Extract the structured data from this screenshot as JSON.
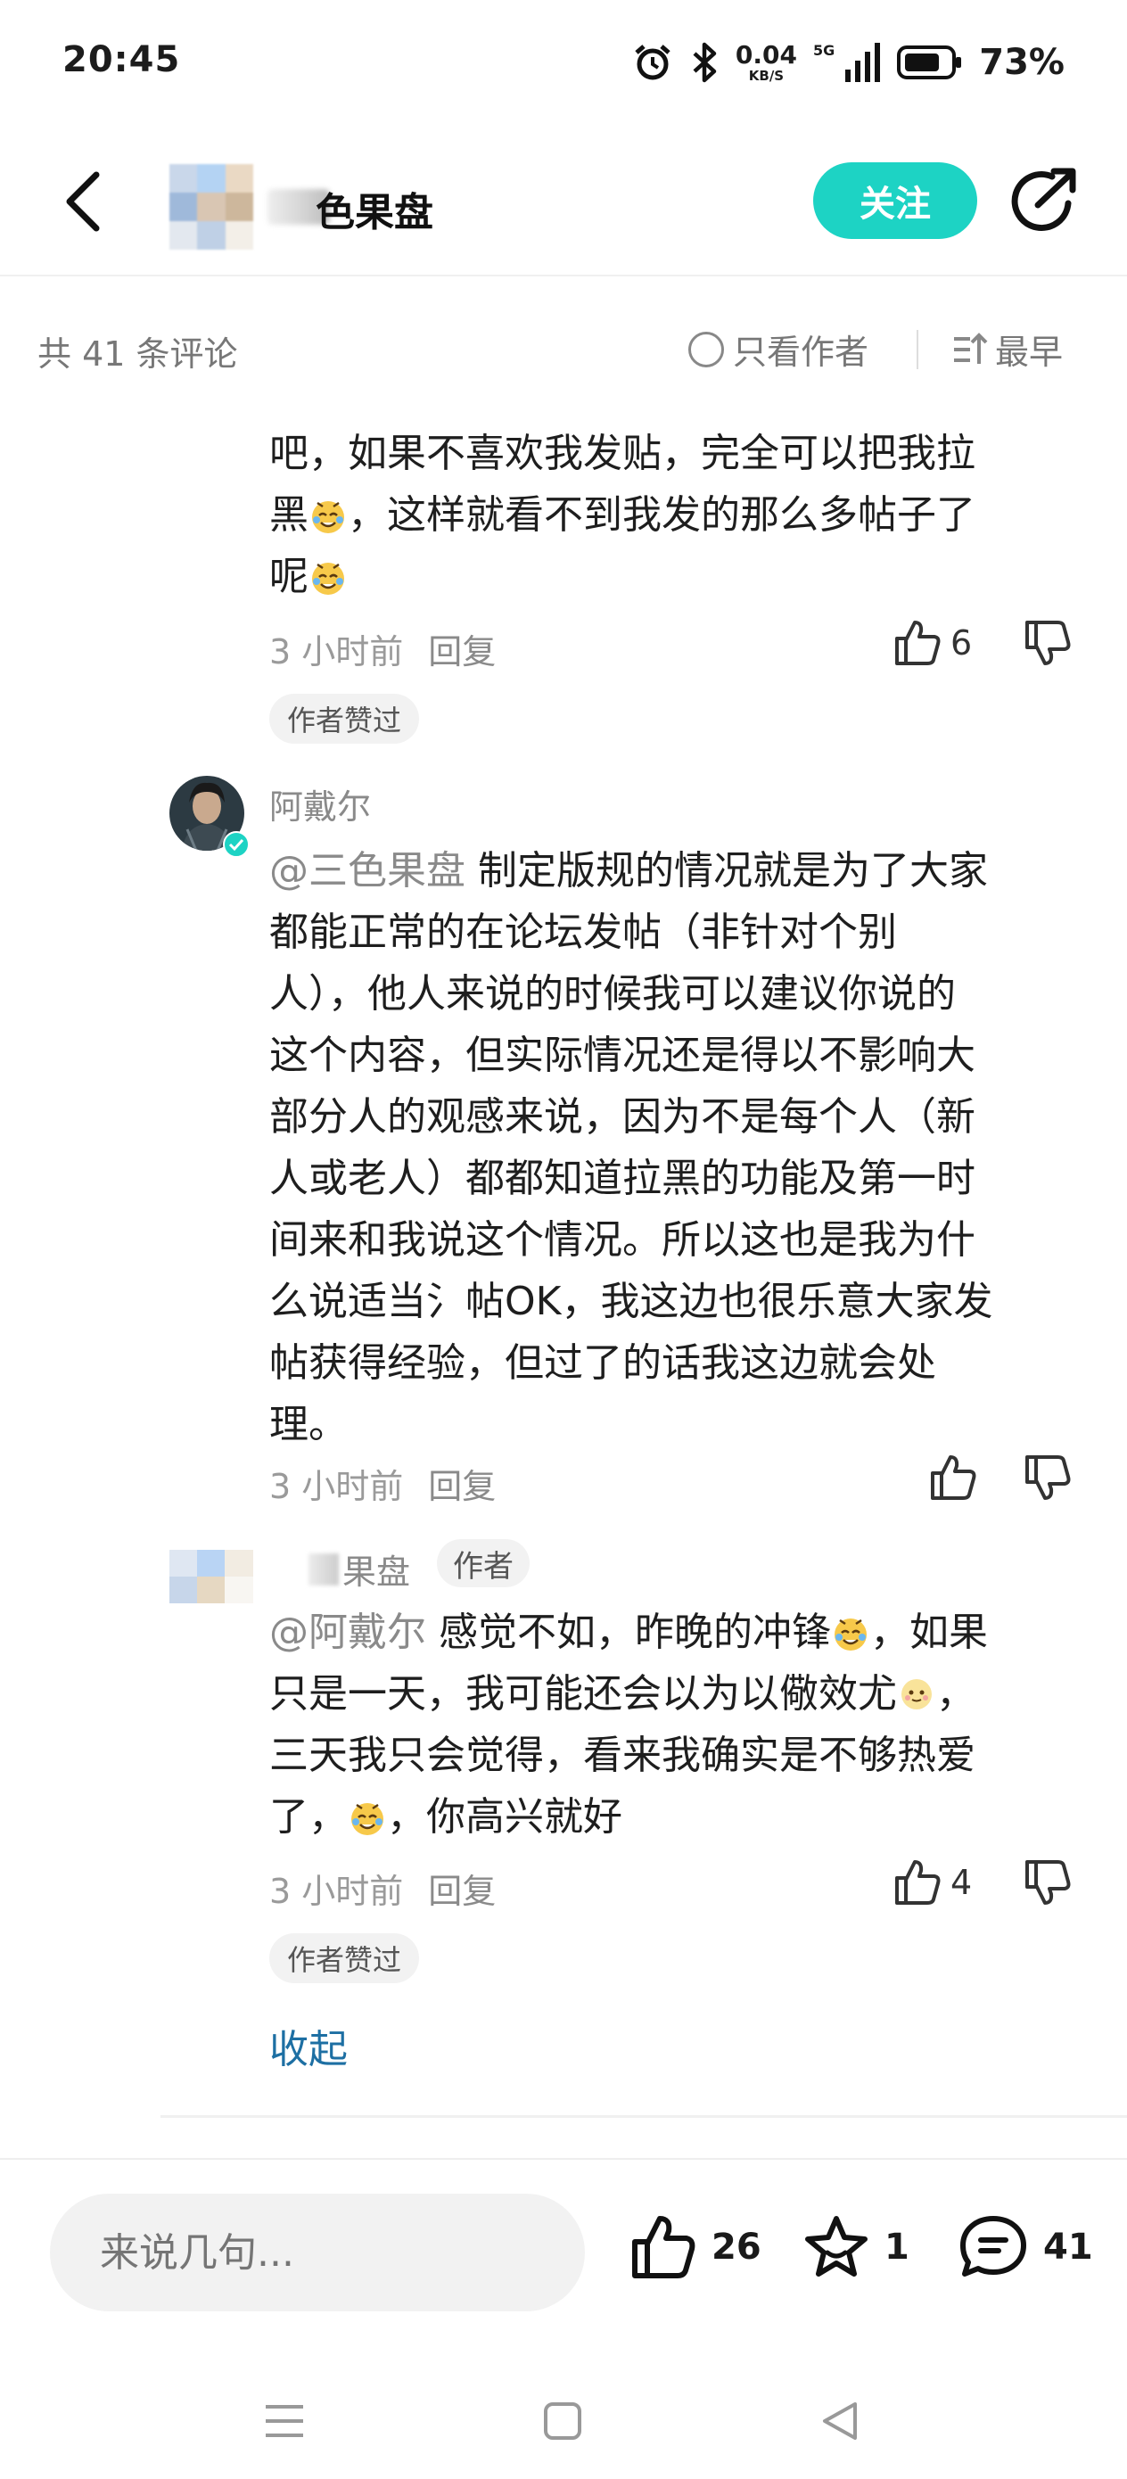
{
  "status_bar": {
    "time": "20:45",
    "net_speed": "0.04",
    "net_speed_unit": "KB/S",
    "network": "5G",
    "battery": "73%"
  },
  "header": {
    "title": "色果盘",
    "follow_label": "关注",
    "icons": {
      "back": "back-arrow-icon",
      "share": "share-icon"
    }
  },
  "comments_bar": {
    "count_label": "共 41 条评论",
    "author_only_label": "只看作者",
    "sort_label": "最早"
  },
  "replies": [
    {
      "lines": [
        "吧，如果不喜欢我发贴，完全可以把我拉",
        "黑",
        "，这样就看不到我发的那么多帖子了",
        "呢"
      ],
      "time": "3 小时前",
      "reply_label": "回复",
      "likes": "6",
      "tag": "作者赞过"
    },
    {
      "name": "阿戴尔",
      "mention": "@三色果盘",
      "lines": [
        "制定版规的情况就是为了大家",
        "都能正常的在论坛发帖（非针对个别",
        "人），他人来说的时候我可以建议你说的",
        "这个内容，但实际情况还是得以不影响大",
        "部分人的观感来说，因为不是每个人（新",
        "人或老人）都都知道拉黑的功能及第一时",
        "间来和我说这个情况。所以这也是我为什",
        "么说适当氵帖OK，我这边也很乐意大家发",
        "帖获得经验，但过了的话我这边就会处",
        "理。"
      ],
      "time": "3 小时前",
      "reply_label": "回复"
    },
    {
      "name": "果盘",
      "badge": "作者",
      "mention": "@阿戴尔",
      "lines": [
        "感觉不如，昨晚的冲锋",
        "，如果",
        "只是一天，我可能还会以为以儆效尤",
        "，",
        "三天我只会觉得，看来我确实是不够热爱",
        "了，",
        "，你高兴就好"
      ],
      "time": "3 小时前",
      "reply_label": "回复",
      "likes": "4",
      "tag": "作者赞过"
    }
  ],
  "collapse_label": "收起",
  "bottom_bar": {
    "input_placeholder": "来说几句...",
    "likes": "26",
    "favorites": "1",
    "comments": "41"
  },
  "colors": {
    "accent": "#1dd3c4",
    "link": "#1d6fa3",
    "muted": "#8a8a8a"
  }
}
